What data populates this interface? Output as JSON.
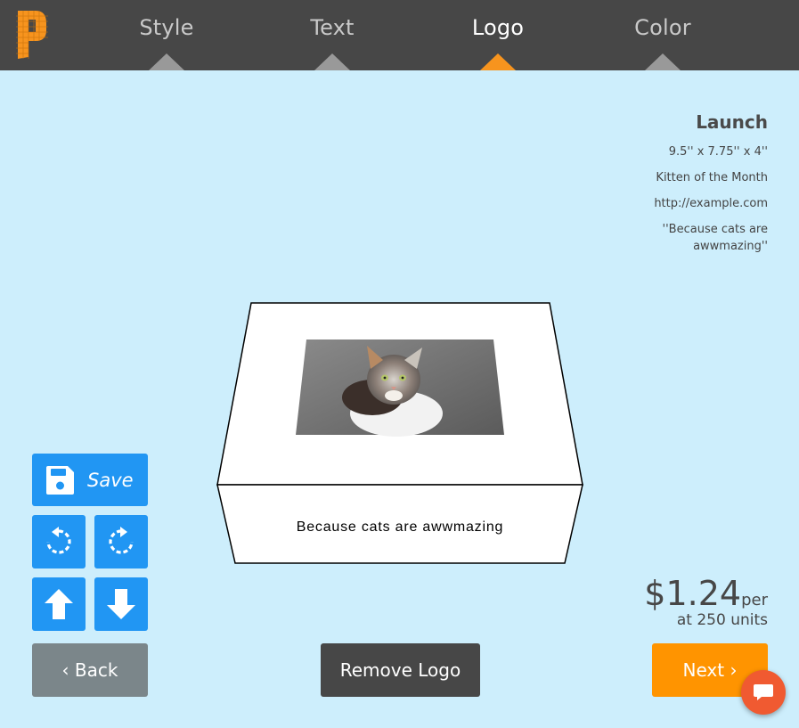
{
  "nav": {
    "tabs": [
      {
        "label": "Style",
        "active": false
      },
      {
        "label": "Text",
        "active": false
      },
      {
        "label": "Logo",
        "active": true
      },
      {
        "label": "Color",
        "active": false
      }
    ]
  },
  "colors": {
    "background": "#cdeefc",
    "topbar": "#474747",
    "accent": "#f7941e",
    "primary_button": "#2196f3",
    "next_button": "#ff9400",
    "back_button": "#7b868a",
    "chat_button": "#f05a31"
  },
  "product": {
    "name": "Launch",
    "dimensions": "9.5'' x 7.75'' x 4''",
    "line1": "Kitten of the Month",
    "line2": "http://example.com",
    "line3": "''Because cats are awwmazing''"
  },
  "box": {
    "side_text": "Because cats are awwmazing",
    "logo_image": "cat photo"
  },
  "toolbar": {
    "save_label": "Save",
    "icons": [
      "save-icon",
      "rotate-left-icon",
      "rotate-right-icon",
      "arrow-up-icon",
      "arrow-down-icon"
    ]
  },
  "price": {
    "amount": "$1.24",
    "per": "per",
    "units": "at 250 units"
  },
  "footer": {
    "back_label": "‹ Back",
    "remove_label": "Remove Logo",
    "next_label": "Next ›"
  }
}
